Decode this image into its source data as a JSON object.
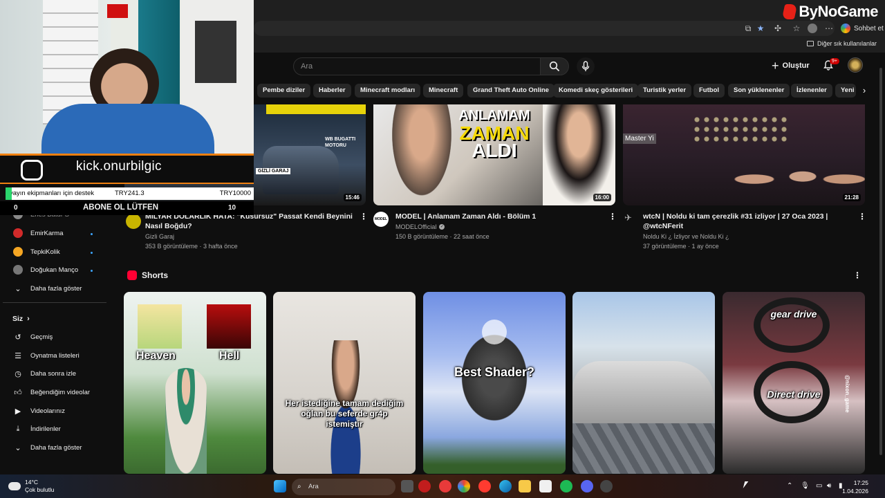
{
  "brand": {
    "logo_text": "ByNoGame"
  },
  "browser": {
    "chat_label": "Sohbet et",
    "bookmarks_other": "Diğer sık kullanılanlar"
  },
  "masthead": {
    "search_placeholder": "Ara",
    "create_label": "Oluştur",
    "notif_count": "9+"
  },
  "chips": [
    "Pembe diziler",
    "Haberler",
    "Minecraft modları",
    "Minecraft",
    "Grand Theft Auto Online",
    "Komedi skeç gösterileri",
    "Turistik yerler",
    "Futbol",
    "Son yüklenenler",
    "İzlenenler",
    "Yeni"
  ],
  "videos": [
    {
      "thumb_text": "WB BUGATTI MOTORU",
      "thumb_badge": "GİZLİ GARAJ",
      "duration": "15:46",
      "title_line1": "MİLYAR DOLARLIK HATA: \"Kusursuz\" Passat Kendi Beynini",
      "title_line2": "Nasıl Boğdu?",
      "channel": "Gizli Garaj",
      "stats": "353 B görüntüleme · 3 hafta önce"
    },
    {
      "thumb_line1": "ANLAMAM",
      "thumb_line2": "ZAMAN",
      "thumb_line3": "ALDI",
      "duration": "16:00",
      "title": "MODEL | Anlamam Zaman Aldı - Bölüm 1",
      "channel": "MODELOfficial",
      "channel_icon_text": "MODEL",
      "stats": "150 B görüntüleme · 22 saat önce"
    },
    {
      "thumb_tag": "Master Yi",
      "duration": "21:28",
      "title_line1": "wtcN | Noldu ki tam çerezlik #31 izliyor | 27 Oca 2023 |",
      "title_line2": "@wtcNFerit",
      "channel": "Noldu Ki ¿ İzliyor ve Noldu Ki ¿",
      "stats": "37 görüntüleme · 1 ay önce"
    }
  ],
  "sidebar": {
    "subs": [
      {
        "label": "Enes Batur S",
        "color": "#888888"
      },
      {
        "label": "EmirKarma",
        "color": "#d12a2a"
      },
      {
        "label": "TepkiKolik",
        "color": "#f5a623"
      },
      {
        "label": "Doğukan Manço",
        "color": "#777777"
      }
    ],
    "show_more_subs": "Daha fazla göster",
    "you_label": "Siz",
    "you_items": [
      {
        "label": "Geçmiş",
        "icon": "history-icon"
      },
      {
        "label": "Oynatma listeleri",
        "icon": "playlists-icon"
      },
      {
        "label": "Daha sonra izle",
        "icon": "watch-later-icon"
      },
      {
        "label": "Beğendiğim videolar",
        "icon": "liked-icon"
      },
      {
        "label": "Videolarınız",
        "icon": "your-videos-icon"
      },
      {
        "label": "İndirilenler",
        "icon": "downloads-icon"
      }
    ],
    "show_more_you": "Daha fazla göster"
  },
  "shorts": {
    "section_title": "Shorts",
    "items": [
      {
        "caption_a": "Heaven",
        "caption_b": "Hell"
      },
      {
        "caption": "Her istediğine tamam dediğim oğlan bu seferde gr4p istemiştir"
      },
      {
        "caption": "Best Shader?"
      },
      {
        "caption": ""
      },
      {
        "caption_a": "gear drive",
        "caption_b": "Direct drive",
        "side_tag": "@nixon_game"
      }
    ]
  },
  "stream_overlay": {
    "kick_handle": "kick.onurbilgic",
    "donate_label": "yayın ekipmanları için destek",
    "donate_current": "TRY241.3",
    "donate_goal": "TRY10000",
    "sub_left": "0",
    "sub_prompt": "ABONE OL LÜTFEN",
    "sub_right": "10"
  },
  "taskbar": {
    "weather_temp": "14°C",
    "weather_desc": "Çok bulutlu",
    "search_label": "Ara",
    "time": "17:25",
    "date": "1.04.2026"
  }
}
